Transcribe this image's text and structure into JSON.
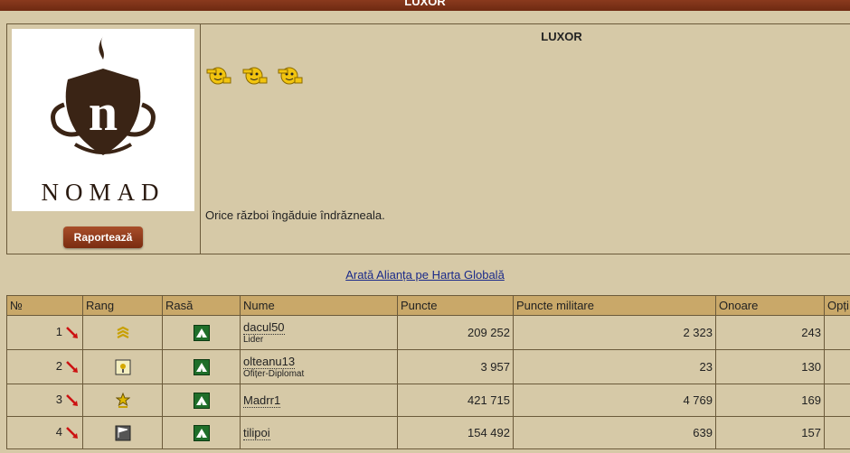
{
  "window": {
    "title": "LUXOR"
  },
  "alliance": {
    "name": "LUXOR",
    "logo_text": "NOMAD",
    "report_button": "Raportează",
    "motto": "Orice război îngăduie îndrăzneala.",
    "smileys": [
      "smiley-salute-icon",
      "smiley-salute-icon",
      "smiley-salute-icon"
    ]
  },
  "map_link": "Arată Alianța pe Harta Globală",
  "table": {
    "headers": {
      "no": "№",
      "rank": "Rang",
      "race": "Rasă",
      "name": "Nume",
      "points": "Puncte",
      "military": "Puncte militare",
      "honor": "Onoare",
      "options": "Opți"
    },
    "rows": [
      {
        "no": "1",
        "rank_icon": "chevrons-rank-icon",
        "race_icon": "tent-race-icon",
        "name": "dacul50",
        "role": "Lider",
        "points": "209 252",
        "military": "2 323",
        "honor": "243"
      },
      {
        "no": "2",
        "rank_icon": "diplomat-rank-icon",
        "race_icon": "tent-race-icon",
        "name": "olteanu13",
        "role": "Ofițer-Diplomat",
        "points": "3 957",
        "military": "23",
        "honor": "130"
      },
      {
        "no": "3",
        "rank_icon": "star-rank-icon",
        "race_icon": "tent-race-icon",
        "name": "Madrr1",
        "role": "",
        "points": "421 715",
        "military": "4 769",
        "honor": "169"
      },
      {
        "no": "4",
        "rank_icon": "flag-rank-icon",
        "race_icon": "tent-race-icon",
        "name": "tilipoi",
        "role": "",
        "points": "154 492",
        "military": "639",
        "honor": "157"
      }
    ]
  },
  "colors": {
    "header_bg": "#c9a869",
    "panel_bg": "#d6c9a7",
    "title_bar": "#7a2c10",
    "link": "#1a2a8a",
    "arrow": "#cc1111"
  }
}
